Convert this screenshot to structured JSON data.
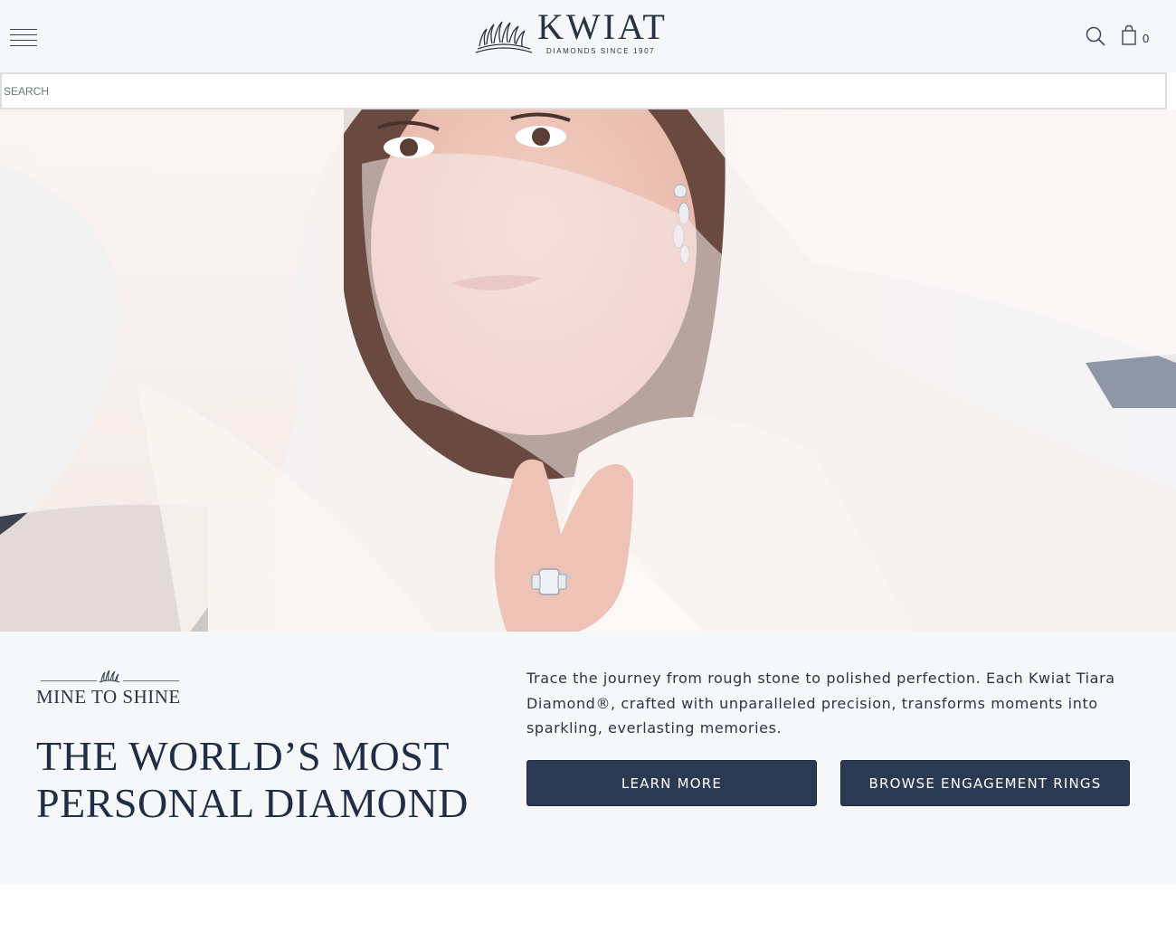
{
  "header": {
    "menu_icon": "hamburger-menu-icon",
    "logo_word": "KWIAT",
    "logo_tagline": "DIAMONDS SINCE 1907",
    "search_icon": "search-icon",
    "cart_icon": "shopping-bag-icon",
    "cart_count": "0"
  },
  "search": {
    "placeholder": "SEARCH",
    "value": ""
  },
  "hero": {
    "image": "bride-in-veil-with-diamond-ring-photo"
  },
  "promo": {
    "eyebrow": "MINE TO SHINE",
    "headline_line1": "THE WORLD’S MOST",
    "headline_line2": "PERSONAL DIAMOND",
    "description": "Trace the journey from rough stone to polished perfection. Each Kwiat Tiara Diamond®, crafted with unparalleled precision, transforms moments into sparkling, everlasting memories.",
    "learn_more_label": "LEARN MORE",
    "browse_label": "BROWSE ENGAGEMENT RINGS"
  },
  "colors": {
    "navy": "#2b3a53",
    "header_bg": "#f6f7f9",
    "text": "#243142"
  }
}
